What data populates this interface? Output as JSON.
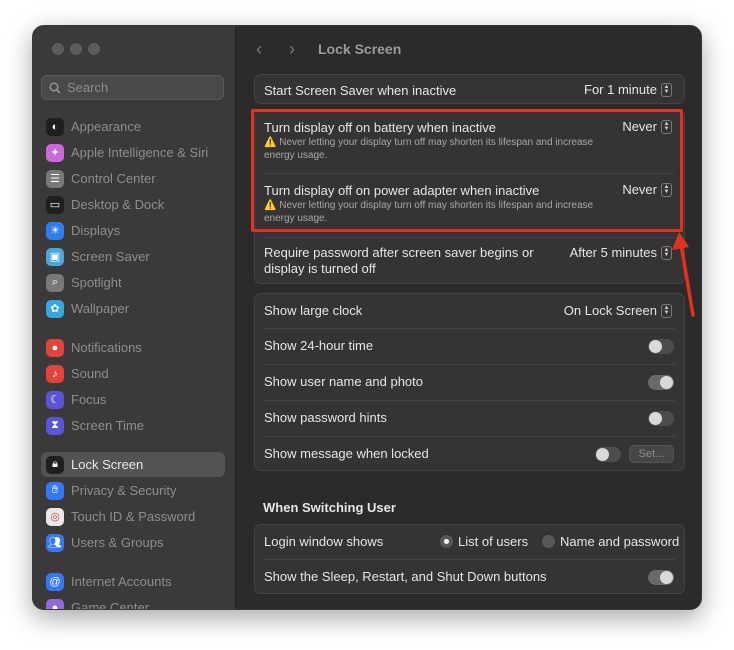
{
  "colors": {
    "highlight": "#e2321e",
    "accent_icons": "multicolor",
    "background": "#2c2a2a"
  },
  "search": {
    "placeholder": "Search"
  },
  "sidebar": {
    "items": [
      {
        "label": "Appearance",
        "icon": "appearance-icon",
        "color": "#1f1f1f",
        "glyph": "◐"
      },
      {
        "label": "Apple Intelligence & Siri",
        "icon": "siri-icon",
        "color": "#c86ad8",
        "glyph": "✦"
      },
      {
        "label": "Control Center",
        "icon": "control-center-icon",
        "color": "#7a7878",
        "glyph": "☰"
      },
      {
        "label": "Desktop & Dock",
        "icon": "desktop-dock-icon",
        "color": "#1f1f1f",
        "glyph": "▭"
      },
      {
        "label": "Displays",
        "icon": "displays-icon",
        "color": "#2f7ef0",
        "glyph": "☀"
      },
      {
        "label": "Screen Saver",
        "icon": "screen-saver-icon",
        "color": "#4aa7d8",
        "glyph": "▣"
      },
      {
        "label": "Spotlight",
        "icon": "spotlight-icon",
        "color": "#7a7878",
        "glyph": "⌕"
      },
      {
        "label": "Wallpaper",
        "icon": "wallpaper-icon",
        "color": "#36a8e0",
        "glyph": "✿"
      },
      {
        "label": "Notifications",
        "icon": "notifications-icon",
        "color": "#e0443a",
        "glyph": "●"
      },
      {
        "label": "Sound",
        "icon": "sound-icon",
        "color": "#e0443a",
        "glyph": "♪"
      },
      {
        "label": "Focus",
        "icon": "focus-icon",
        "color": "#5a55d6",
        "glyph": "☾"
      },
      {
        "label": "Screen Time",
        "icon": "screen-time-icon",
        "color": "#5a55d6",
        "glyph": "⧗"
      },
      {
        "label": "Lock Screen",
        "icon": "lock-screen-icon",
        "color": "#1f1f1f",
        "glyph": "🔒︎"
      },
      {
        "label": "Privacy & Security",
        "icon": "privacy-hand-icon",
        "color": "#3478f6",
        "glyph": "✋︎"
      },
      {
        "label": "Touch ID & Password",
        "icon": "touch-id-icon",
        "color": "#e8e8e8",
        "glyph": "◎"
      },
      {
        "label": "Users & Groups",
        "icon": "users-groups-icon",
        "color": "#3478f6",
        "glyph": "👥︎"
      },
      {
        "label": "Internet Accounts",
        "icon": "internet-accounts-icon",
        "color": "#3478f6",
        "glyph": "@"
      },
      {
        "label": "Game Center",
        "icon": "game-center-icon",
        "color": "#8f6ad8",
        "glyph": "●"
      }
    ]
  },
  "header": {
    "title": "Lock Screen"
  },
  "screen_saver": {
    "label": "Start Screen Saver when inactive",
    "value": "For 1 minute"
  },
  "display_off": {
    "battery_label": "Turn display off on battery when inactive",
    "battery_value": "Never",
    "battery_warning": "⚠️ Never letting your display turn off may shorten its lifespan and increase energy usage.",
    "adapter_label": "Turn display off on power adapter when inactive",
    "adapter_value": "Never",
    "adapter_warning": "⚠️ Never letting your display turn off may shorten its lifespan and increase energy usage."
  },
  "password": {
    "label": "Require password after screen saver begins or display is turned off",
    "value": "After 5 minutes"
  },
  "clock": {
    "large_label": "Show large clock",
    "large_value": "On Lock Screen",
    "h24_label": "Show 24-hour time",
    "h24_on": false
  },
  "user": {
    "name_photo_label": "Show user name and photo",
    "name_photo_on": true,
    "hints_label": "Show password hints",
    "hints_on": false
  },
  "message": {
    "label": "Show message when locked",
    "on": false,
    "set_label": "Set..."
  },
  "switching": {
    "heading": "When Switching User",
    "login_label": "Login window shows",
    "opt_list": "List of users",
    "opt_name": "Name and password",
    "selected": "List of users",
    "sleep_label": "Show the Sleep, Restart, and Shut Down buttons",
    "sleep_on": true
  }
}
